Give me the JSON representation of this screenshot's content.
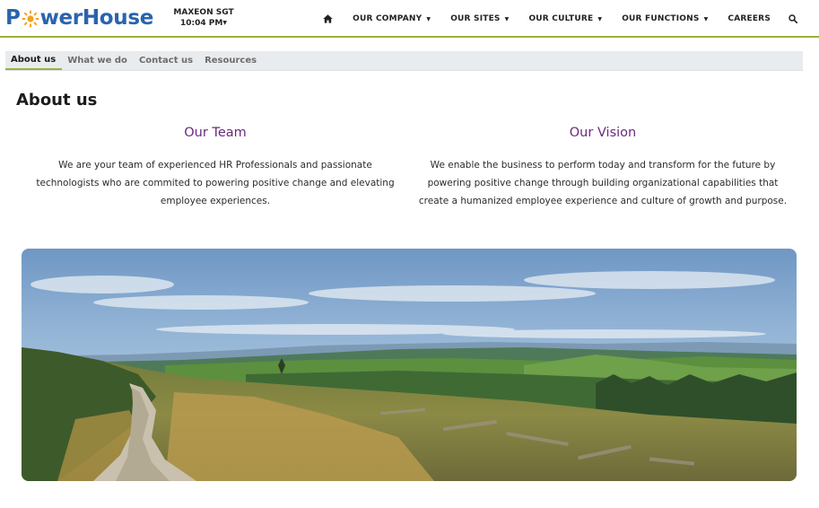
{
  "brand": {
    "name_prefix": "P",
    "name_suffix": "werHouse"
  },
  "clock": {
    "label": "MAXEON SGT",
    "time": "10:04 PM"
  },
  "nav": {
    "items": [
      {
        "label": "OUR COMPANY"
      },
      {
        "label": "OUR SITES"
      },
      {
        "label": "OUR CULTURE"
      },
      {
        "label": "OUR FUNCTIONS"
      },
      {
        "label": "CAREERS"
      }
    ]
  },
  "subtabs": [
    {
      "label": "About us"
    },
    {
      "label": "What we do"
    },
    {
      "label": "Contact us"
    },
    {
      "label": "Resources"
    }
  ],
  "page": {
    "title": "About us"
  },
  "team": {
    "heading": "Our Team",
    "body": "We are your team of experienced HR Professionals and passionate technologists who are commited to powering positive change and elevating employee experiences."
  },
  "vision": {
    "heading": "Our Vision",
    "body": "We enable the business to perform today and transform for the future by powering positive change through building organizational capabilities that create a humanized employee experience and culture of growth and purpose."
  },
  "colors": {
    "accent": "#9ab33a",
    "brand_blue": "#2a64ad",
    "heading_purple": "#6a2a7b",
    "sun_orange": "#f4a11c"
  },
  "icons": {
    "home": "home-icon",
    "search": "search-icon",
    "hero": "landscape-image"
  }
}
